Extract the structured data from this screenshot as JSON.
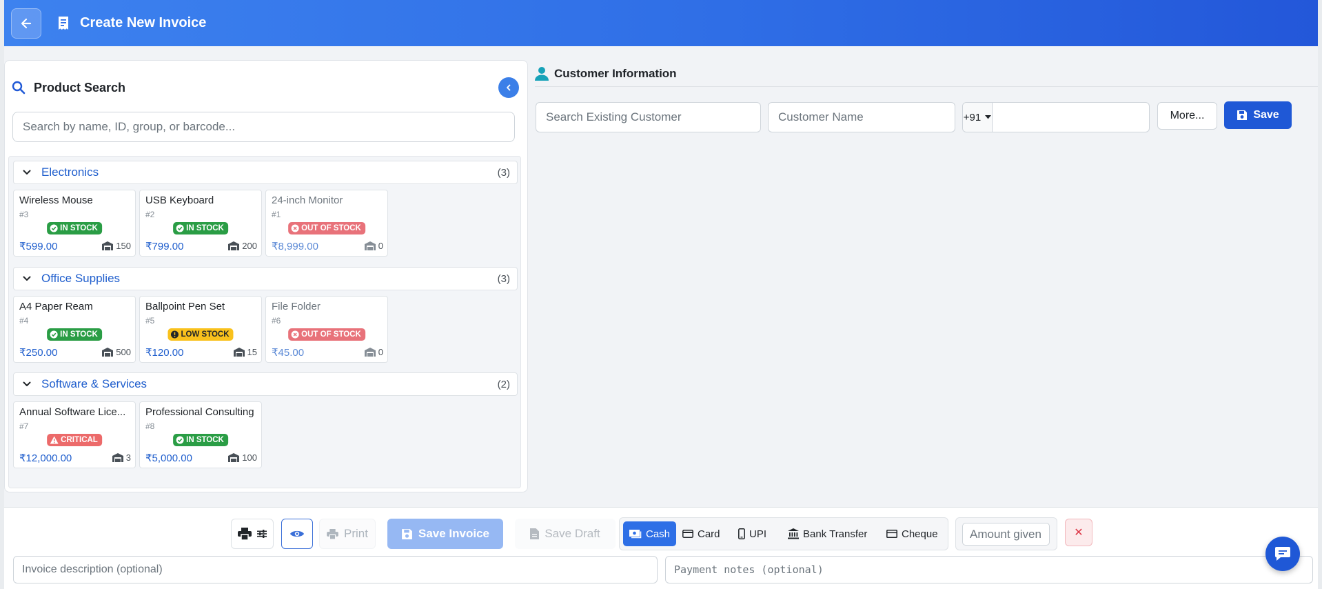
{
  "colors": {
    "primary": "#1f58d6",
    "header_start": "#3d82ef",
    "in_stock": "#2a9d45",
    "out_stock": "#e8727a",
    "low_stock": "#f9c11c",
    "critical": "#ec6a6a"
  },
  "header": {
    "title": "Create New Invoice",
    "back_icon": "arrow-left-icon",
    "title_icon": "receipt-icon"
  },
  "product_search": {
    "title": "Product Search",
    "placeholder": "Search by name, ID, group, or barcode...",
    "groups": [
      {
        "name": "Electronics",
        "count": "(3)",
        "products": [
          {
            "name": "Wireless Mouse",
            "id": "#3",
            "status": "IN STOCK",
            "price": "₹599.00",
            "stock": "150"
          },
          {
            "name": "USB Keyboard",
            "id": "#2",
            "status": "IN STOCK",
            "price": "₹799.00",
            "stock": "200"
          },
          {
            "name": "24-inch Monitor",
            "id": "#1",
            "status": "OUT OF STOCK",
            "price": "₹8,999.00",
            "stock": "0"
          }
        ]
      },
      {
        "name": "Office Supplies",
        "count": "(3)",
        "products": [
          {
            "name": "A4 Paper Ream",
            "id": "#4",
            "status": "IN STOCK",
            "price": "₹250.00",
            "stock": "500"
          },
          {
            "name": "Ballpoint Pen Set",
            "id": "#5",
            "status": "LOW STOCK",
            "price": "₹120.00",
            "stock": "15"
          },
          {
            "name": "File Folder",
            "id": "#6",
            "status": "OUT OF STOCK",
            "price": "₹45.00",
            "stock": "0"
          }
        ]
      },
      {
        "name": "Software & Services",
        "count": "(2)",
        "products": [
          {
            "name": "Annual Software Lice...",
            "id": "#7",
            "status": "CRITICAL",
            "price": "₹12,000.00",
            "stock": "3"
          },
          {
            "name": "Professional Consulting",
            "id": "#8",
            "status": "IN STOCK",
            "price": "₹5,000.00",
            "stock": "100"
          }
        ]
      }
    ]
  },
  "customer": {
    "title": "Customer Information",
    "search_placeholder": "Search Existing Customer",
    "name_placeholder": "Customer Name",
    "phone_code": "+91",
    "more_label": "More...",
    "save_label": "Save"
  },
  "footer": {
    "print_label": "Print",
    "save_invoice_label": "Save Invoice",
    "save_draft_label": "Save Draft",
    "payment_methods": [
      {
        "label": "Cash",
        "active": true
      },
      {
        "label": "Card"
      },
      {
        "label": "UPI"
      },
      {
        "label": "Bank Transfer"
      },
      {
        "label": "Cheque"
      }
    ],
    "amount_placeholder": "Amount given",
    "clear_label": "✕",
    "description_placeholder": "Invoice description (optional)",
    "notes_placeholder": "Payment notes (optional)"
  }
}
